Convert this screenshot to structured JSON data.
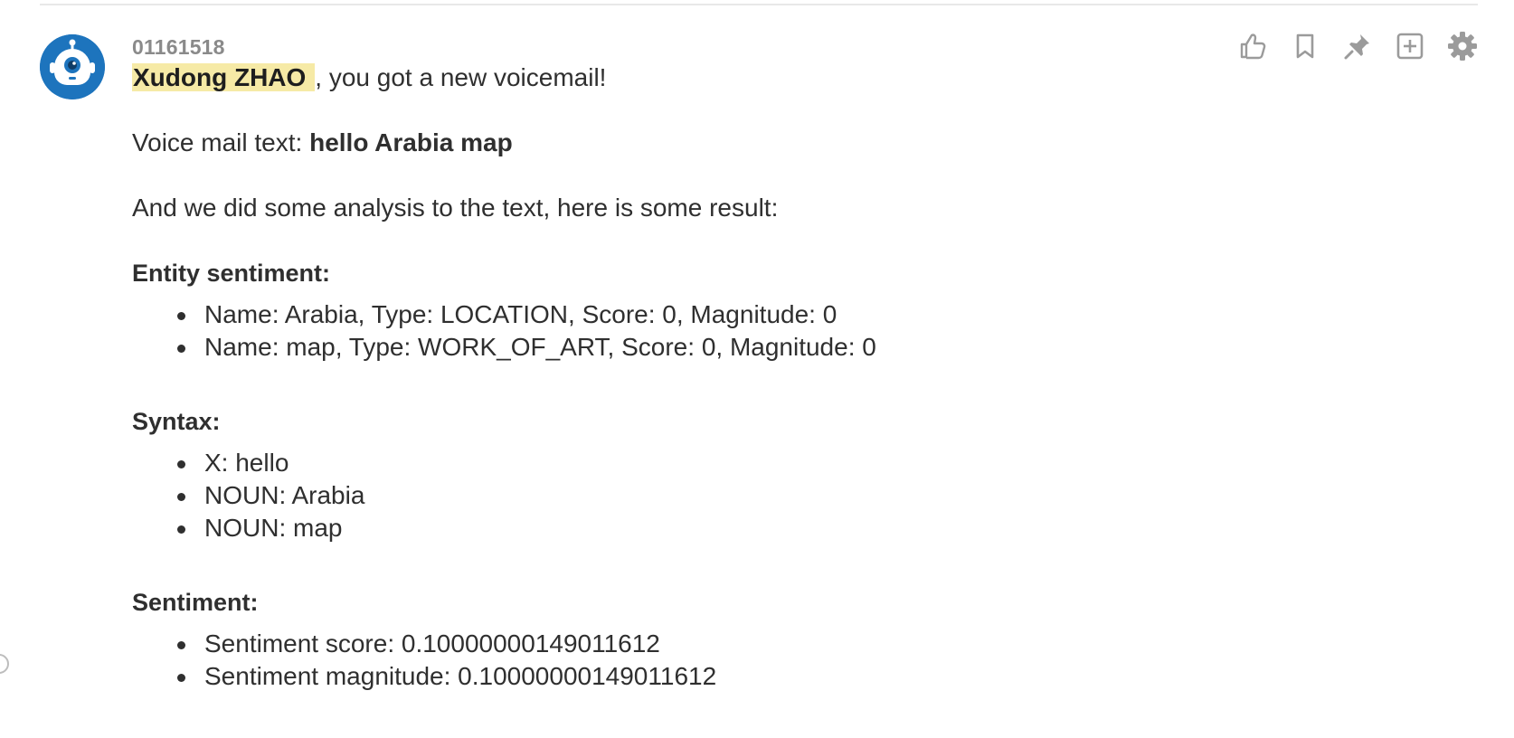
{
  "message": {
    "sender": "01161518",
    "mention": "Xudong ZHAO",
    "greeting_rest": ", you got a new voicemail!",
    "voicemail_label": "Voice mail text: ",
    "voicemail_text": "hello Arabia map",
    "analysis_intro": "And we did some analysis to the text, here is some result:",
    "sections": {
      "entity_sentiment": {
        "heading": "Entity sentiment:",
        "items": [
          "Name: Arabia, Type: LOCATION, Score: 0, Magnitude: 0",
          "Name: map, Type: WORK_OF_ART, Score: 0, Magnitude: 0"
        ]
      },
      "syntax": {
        "heading": "Syntax:",
        "items": [
          "X: hello",
          "NOUN: Arabia",
          "NOUN: map"
        ]
      },
      "sentiment": {
        "heading": "Sentiment:",
        "items": [
          "Sentiment score: 0.10000000149011612",
          "Sentiment magnitude: 0.10000000149011612"
        ]
      }
    }
  },
  "actions": [
    {
      "icon": "thumbs-up-icon"
    },
    {
      "icon": "bookmark-icon"
    },
    {
      "icon": "pin-icon"
    },
    {
      "icon": "add-square-icon"
    },
    {
      "icon": "gear-icon"
    }
  ],
  "colors": {
    "avatar_bg": "#1d74bd",
    "mention_bg": "#f6eaa6",
    "text": "#2f2f2f",
    "muted": "#8a8a8a",
    "icon": "#9b9b9b"
  }
}
